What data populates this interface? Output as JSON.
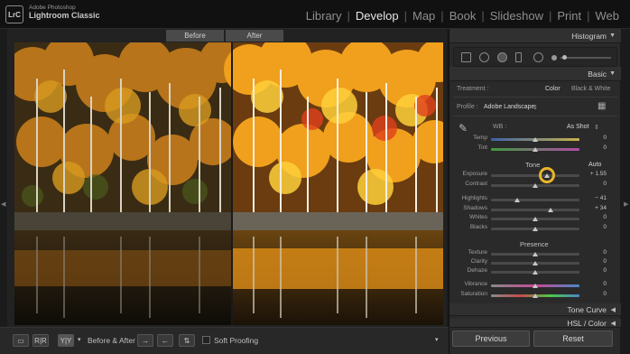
{
  "brand": {
    "logo": "LrC",
    "line1": "Adobe Photoshop",
    "line2": "Lightroom Classic"
  },
  "modules": [
    "Library",
    "Develop",
    "Map",
    "Book",
    "Slideshow",
    "Print",
    "Web"
  ],
  "active_module": "Develop",
  "view_labels": {
    "before": "Before",
    "after": "After"
  },
  "toolbar": {
    "view_icons": [
      "loupe-view-icon",
      "before-after-left-right-icon",
      "before-after-split-icon"
    ],
    "before_after_label": "Before & After :",
    "swap_buttons": [
      "copy-before-to-after-icon",
      "copy-after-to-before-icon",
      "swap-before-after-icon"
    ],
    "soft_proofing_label": "Soft Proofing"
  },
  "panel": {
    "histogram": "Histogram",
    "basic": "Basic",
    "treatment": {
      "label": "Treatment :",
      "color": "Color",
      "bw": "Black & White"
    },
    "profile": {
      "label": "Profile :",
      "value": "Adobe Landscape"
    },
    "wb": {
      "label": "WB :",
      "value": "As Shot"
    },
    "tone": {
      "label": "Tone",
      "auto": "Auto"
    },
    "presence": "Presence",
    "tone_curve": "Tone Curve",
    "hsl": "HSL / Color",
    "sliders": [
      {
        "key": "temp",
        "label": "Temp",
        "value": "0",
        "pos": 0.5
      },
      {
        "key": "tint",
        "label": "Tint",
        "value": "0",
        "pos": 0.5
      },
      {
        "key": "exposure",
        "label": "Exposure",
        "value": "+ 1.55",
        "pos": 0.63
      },
      {
        "key": "contrast",
        "label": "Contrast",
        "value": "0",
        "pos": 0.5
      },
      {
        "key": "highlights",
        "label": "Highlights",
        "value": "− 41",
        "pos": 0.3
      },
      {
        "key": "shadows",
        "label": "Shadows",
        "value": "+ 34",
        "pos": 0.67
      },
      {
        "key": "whites",
        "label": "Whites",
        "value": "0",
        "pos": 0.5
      },
      {
        "key": "blacks",
        "label": "Blacks",
        "value": "0",
        "pos": 0.5
      },
      {
        "key": "texture",
        "label": "Texture",
        "value": "0",
        "pos": 0.5
      },
      {
        "key": "clarity",
        "label": "Clarity",
        "value": "0",
        "pos": 0.5
      },
      {
        "key": "dehaze",
        "label": "Dehaze",
        "value": "0",
        "pos": 0.5
      },
      {
        "key": "vibrance",
        "label": "Vibrance",
        "value": "0",
        "pos": 0.5
      },
      {
        "key": "saturation",
        "label": "Saturation",
        "value": "0",
        "pos": 0.5
      }
    ],
    "previous": "Previous",
    "reset": "Reset"
  },
  "colors": {
    "accent_ring": "#e8b52a",
    "panel_bg": "#2a2a2a",
    "app_bg": "#1b1b1b"
  }
}
